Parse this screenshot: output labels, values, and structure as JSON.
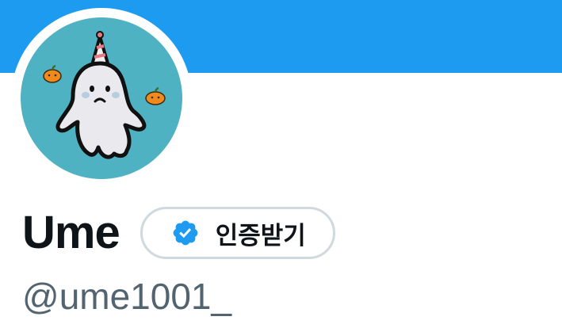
{
  "profile": {
    "display_name": "Ume",
    "handle": "@ume1001_",
    "avatar_description": "ghost-with-party-hat-icon"
  },
  "verify_button": {
    "label": "인증받기",
    "icon": "verified-badge-icon"
  },
  "colors": {
    "banner": "#1d9bf0",
    "avatar_background": "#4fb2c3",
    "badge": "#1d9bf0",
    "name_text": "#0f1419",
    "handle_text": "#536471",
    "button_border": "#cfd9de"
  }
}
